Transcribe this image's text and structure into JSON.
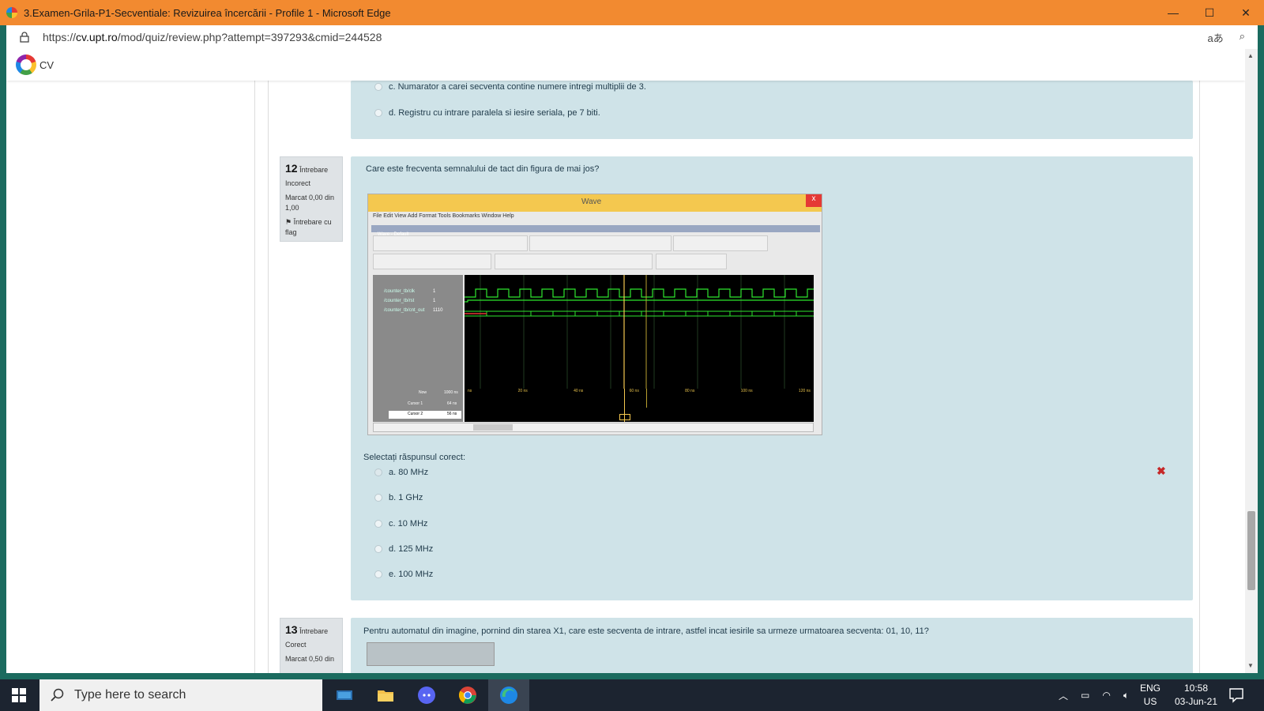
{
  "window": {
    "title": "3.Examen-Grila-P1-Secventiale: Revizuirea încercării - Profile 1 - Microsoft Edge",
    "controls": {
      "minimize": "—",
      "maximize": "☐",
      "close": "✕"
    }
  },
  "address": {
    "url_prefix": "https://",
    "url_domain": "cv.upt.ro",
    "url_path": "/mod/quiz/review.php?attempt=397293&cmid=244528",
    "read_aloud_icon": "aあ",
    "zoom_icon": "⌕"
  },
  "site": {
    "name": "CV"
  },
  "previous_question": {
    "options": [
      "c. Numarator a carei secventa contine numere intregi multiplii de 3.",
      "d. Registru cu intrare paralela si iesire seriala, pe 7 biti."
    ]
  },
  "q12": {
    "number": "12",
    "type_label": "Întrebare",
    "status": "Incorect",
    "mark": "Marcat 0,00 din 1,00",
    "flag": "Întrebare cu flag",
    "text": "Care este frecventa semnalului de tact din figura de mai jos?",
    "prompt": "Selectați răspunsul corect:",
    "options": [
      "a. 80 MHz",
      "b. 1 GHz",
      "c. 10 MHz",
      "d.  125 MHz",
      "e. 100 MHz"
    ],
    "wrong_mark": "✖"
  },
  "wave_image": {
    "title": "Wave",
    "menu": "File   Edit   View   Add   Format   Tools   Bookmarks   Window   Help",
    "bar_label": "Wave - Default",
    "signals": [
      "/counter_tb/clk",
      "/counter_tb/rst",
      "/counter_tb/cnt_out"
    ],
    "signal_values": [
      "1",
      "1",
      "1110"
    ],
    "now_label": "Now",
    "now_value": "1000 ns",
    "cursor1_label": "Cursor 1",
    "cursor1_value": "64 ns",
    "cursor2_label": "Cursor 2",
    "cursor2_value": "56 ns",
    "time_ticks": [
      "ns",
      "20 ns",
      "40 ns",
      "60 ns",
      "80 ns",
      "100 ns",
      "120 ns"
    ]
  },
  "q13": {
    "number": "13",
    "type_label": "Întrebare",
    "status": "Corect",
    "mark": "Marcat 0,50 din",
    "text": "Pentru automatul din imagine, pornind din starea X1, care este secventa de intrare, astfel incat iesirile sa urmeze urmatoarea secventa: 01, 10, 11?"
  },
  "taskbar": {
    "search_placeholder": "Type here to search",
    "lang_top": "ENG",
    "lang_bottom": "US",
    "time": "10:58",
    "date": "03-Jun-21"
  }
}
